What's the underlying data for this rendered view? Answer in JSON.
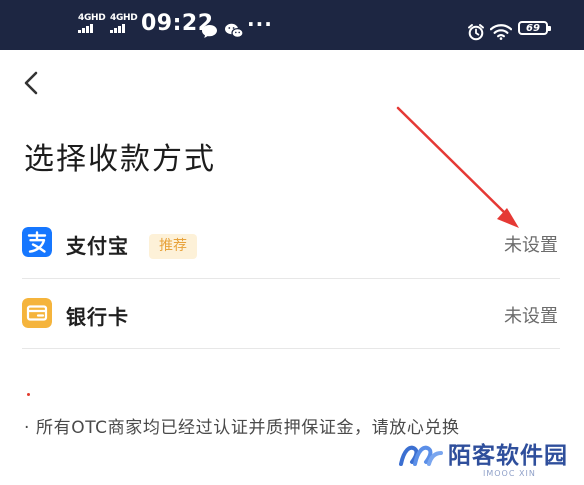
{
  "status_bar": {
    "signal_1": "4GHD",
    "signal_2": "4GHD",
    "time": "09:22",
    "more": "···",
    "battery": "69",
    "icons": [
      "signal-icon",
      "signal-icon",
      "message-icon",
      "wechat-icon",
      "alarm-icon",
      "wifi-icon",
      "battery-icon"
    ]
  },
  "header": {
    "back_icon": "back-arrow-icon"
  },
  "page": {
    "title": "选择收款方式"
  },
  "methods": [
    {
      "name": "支付宝",
      "badge": "推荐",
      "status": "未设置",
      "icon": "alipay-icon",
      "color": "#1677ff"
    },
    {
      "name": "银行卡",
      "status": "未设置",
      "icon": "bank-card-icon",
      "color": "#f5b43c"
    }
  ],
  "notice": "· 所有OTC商家均已经过认证并质押保证金，请放心兑换",
  "watermark": {
    "title": "陌客软件园",
    "subtitle": "IMOOC XIN"
  },
  "colors": {
    "status_bar_bg": "#1d2642",
    "annotation_arrow": "#e53935",
    "badge_text": "#e8a23a"
  }
}
